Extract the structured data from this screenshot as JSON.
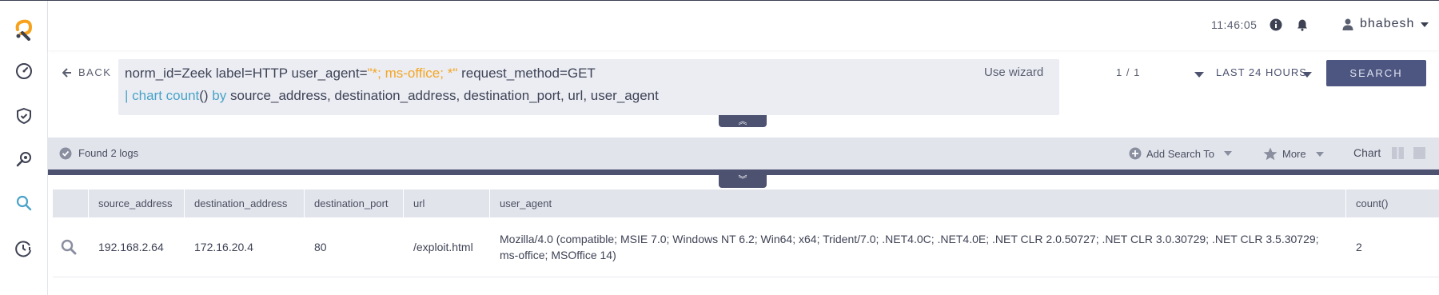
{
  "topbar": {
    "time": "11:46:05",
    "username": "bhabesh"
  },
  "sidebar": {
    "items": [
      {
        "icon": "dashboard-icon"
      },
      {
        "icon": "shield-check-icon"
      },
      {
        "icon": "investigate-icon"
      },
      {
        "icon": "search-icon"
      },
      {
        "icon": "alert-clock-icon"
      }
    ]
  },
  "query": {
    "back_label": "BACK",
    "line1_a": "norm_id=Zeek label=HTTP user_agent=",
    "line1_b": "\"*; ms-office; *\"",
    "line1_c": " request_method=GET",
    "line2_pipe": "| ",
    "line2_chart": "chart count",
    "line2_paren": "() ",
    "line2_by": "by",
    "line2_fields": " source_address, destination_address, destination_port, url, user_agent",
    "use_wizard": "Use wizard"
  },
  "pagination": "1 / 1",
  "time_range": "LAST 24 HOURS",
  "search_button": "SEARCH",
  "results": {
    "found": "Found 2 logs",
    "add_search_to": "Add Search To",
    "more": "More",
    "chart": "Chart"
  },
  "table": {
    "columns": [
      "source_address",
      "destination_address",
      "destination_port",
      "url",
      "user_agent",
      "count()"
    ],
    "rows": [
      {
        "source_address": "192.168.2.64",
        "destination_address": "172.16.20.4",
        "destination_port": "80",
        "url": "/exploit.html",
        "user_agent": "Mozilla/4.0 (compatible; MSIE 7.0; Windows NT 6.2; Win64; x64; Trident/7.0; .NET4.0C; .NET4.0E; .NET CLR 2.0.50727; .NET CLR 3.0.30729; .NET CLR 3.5.30729; ms-office; MSOffice 14)",
        "count": "2"
      }
    ]
  },
  "colors": {
    "accent": "#4d5270",
    "orange": "#f5a623",
    "blue": "#4aa3c8",
    "logo_orange": "#f7a21b"
  }
}
